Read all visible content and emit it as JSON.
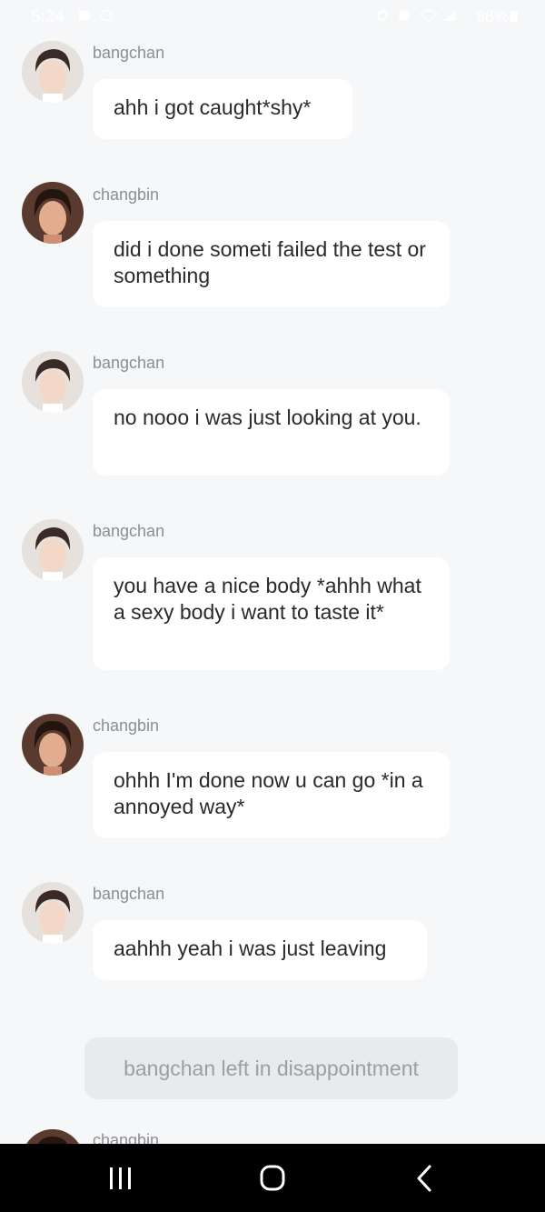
{
  "status_bar": {
    "time": "5:24",
    "battery": "88%",
    "icons": [
      "gallery-icon",
      "circle-icon",
      "alarm-icon",
      "clock-icon",
      "wifi-icon",
      "signal-icon",
      "battery-icon"
    ]
  },
  "messages": [
    {
      "sender": "bangchan",
      "text": "ahh i got caught*shy*"
    },
    {
      "sender": "changbin",
      "text": "did i done someti failed the test or something"
    },
    {
      "sender": "bangchan",
      "text": "no nooo i was just looking at you."
    },
    {
      "sender": "bangchan",
      "text": "you have a nice body *ahhh what a sexy body i want to taste it*"
    },
    {
      "sender": "changbin",
      "text": "ohhh I'm done now u can go *in a annoyed way*"
    },
    {
      "sender": "bangchan",
      "text": "aahhh yeah i was just leaving"
    }
  ],
  "system_note": "bangchan left in disappointment",
  "partial_message": {
    "sender": "changbin"
  },
  "nav": {
    "icons": [
      "recents-icon",
      "home-icon",
      "back-icon"
    ]
  },
  "colors": {
    "background": "#f6f7f9",
    "bubble": "#ffffff",
    "sender_text": "#8b8e93",
    "system_bubble": "#e9eaec",
    "nav_bar": "#000000"
  }
}
